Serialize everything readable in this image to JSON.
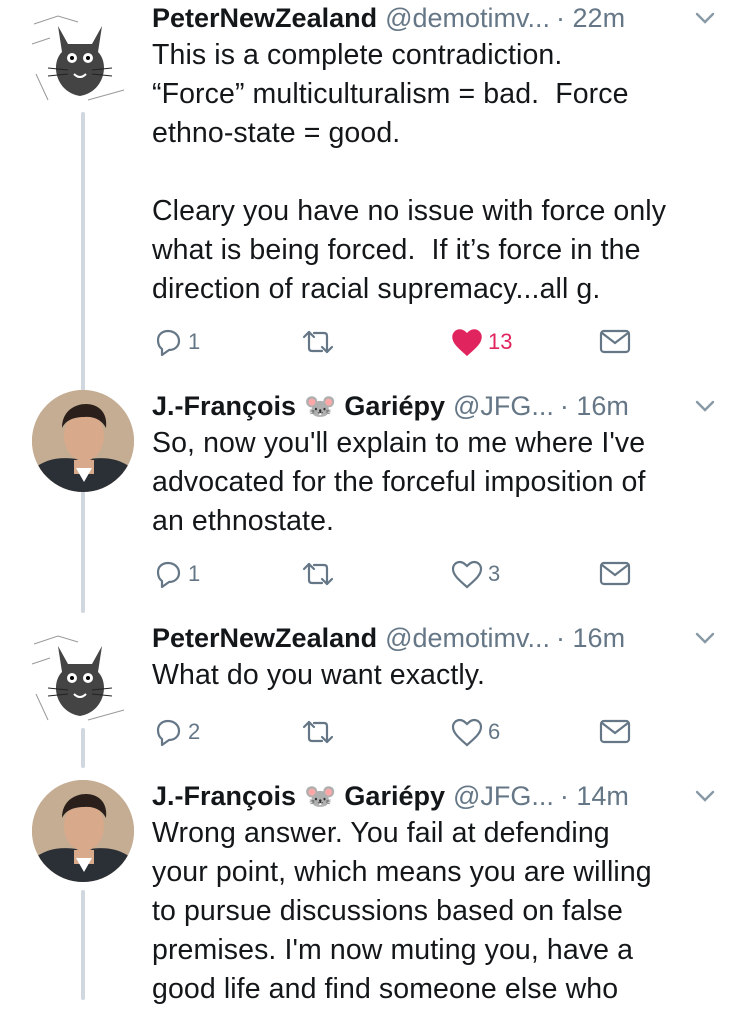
{
  "tweets": [
    {
      "author": "PeterNewZealand",
      "handle": "@demotimv...",
      "emoji": "",
      "name_suffix": "",
      "time": "· 22m",
      "text": "This is a complete contradiction.\n“Force” multiculturalism = bad.  Force\nethno-state = good.\n\nCleary you have no issue with force only\nwhat is being forced.  If it’s force in the\ndirection of racial supremacy...all g.",
      "replies": "1",
      "retweets": "",
      "likes": "13",
      "liked": true
    },
    {
      "author": "J.-François",
      "emoji": "🐭",
      "name_suffix": "Gariépy",
      "handle": "@JFG...",
      "time": "· 16m",
      "text": "So, now you'll explain to me where I've\nadvocated for the forceful imposition of\nan ethnostate.",
      "replies": "1",
      "retweets": "",
      "likes": "3",
      "liked": false
    },
    {
      "author": "PeterNewZealand",
      "handle": "@demotimv...",
      "emoji": "",
      "name_suffix": "",
      "time": "· 16m",
      "text": "What do you want exactly.",
      "replies": "2",
      "retweets": "",
      "likes": "6",
      "liked": false
    },
    {
      "author": "J.-François",
      "emoji": "🐭",
      "name_suffix": "Gariépy",
      "handle": "@JFG...",
      "time": "· 14m",
      "text": "Wrong answer. You fail at defending\nyour point, which means you are willing\nto pursue discussions based on false\npremises. I'm now muting you, have a\ngood life and find someone else who",
      "replies": "",
      "retweets": "",
      "likes": "",
      "liked": false
    }
  ],
  "colors": {
    "like_active": "#e0245e",
    "meta": "#657786",
    "thread_line": "#d0d7de"
  },
  "icons": [
    "reply-icon",
    "retweet-icon",
    "heart-icon",
    "dm-icon",
    "chevron-down-icon"
  ]
}
